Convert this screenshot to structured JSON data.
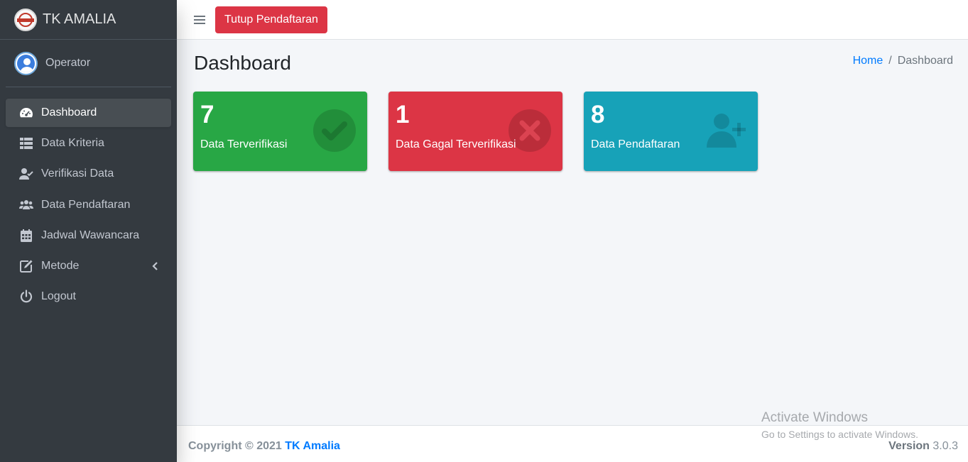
{
  "brand": {
    "name": "TK AMALIA",
    "logo_icon": "school-logo-icon"
  },
  "user": {
    "name": "Operator",
    "avatar_icon": "user-avatar-icon"
  },
  "sidebar": {
    "items": [
      {
        "label": "Dashboard",
        "icon": "tachometer-icon",
        "active": true
      },
      {
        "label": "Data Kriteria",
        "icon": "table-list-icon"
      },
      {
        "label": "Verifikasi Data",
        "icon": "user-check-icon"
      },
      {
        "label": "Data Pendaftaran",
        "icon": "users-icon"
      },
      {
        "label": "Jadwal Wawancara",
        "icon": "calendar-icon"
      },
      {
        "label": "Metode",
        "icon": "edit-icon",
        "has_submenu": true
      },
      {
        "label": "Logout",
        "icon": "power-icon"
      }
    ]
  },
  "header": {
    "toggle_icon": "hamburger-icon",
    "close_button_label": "Tutup Pendaftaran"
  },
  "page": {
    "title": "Dashboard"
  },
  "breadcrumb": {
    "home": "Home",
    "separator": "/",
    "current": "Dashboard"
  },
  "stats": [
    {
      "value": "7",
      "label": "Data Terverifikasi",
      "color": "#28a745",
      "icon": "check-circle-icon"
    },
    {
      "value": "1",
      "label": "Data Gagal Terverifikasi",
      "color": "#dc3545",
      "icon": "times-circle-icon"
    },
    {
      "value": "8",
      "label": "Data Pendaftaran",
      "color": "#17a2b8",
      "icon": "user-plus-icon"
    }
  ],
  "footer": {
    "copyright_prefix": "Copyright © 2021",
    "copyright_link": "TK Amalia",
    "version_label": "Version",
    "version_number": "3.0.3"
  },
  "watermark": {
    "line1": "Activate Windows",
    "line2": "Go to Settings to activate Windows."
  },
  "colors": {
    "sidebar_bg": "#343a40",
    "primary": "#007bff",
    "success": "#28a745",
    "danger": "#dc3545",
    "info": "#17a2b8"
  }
}
